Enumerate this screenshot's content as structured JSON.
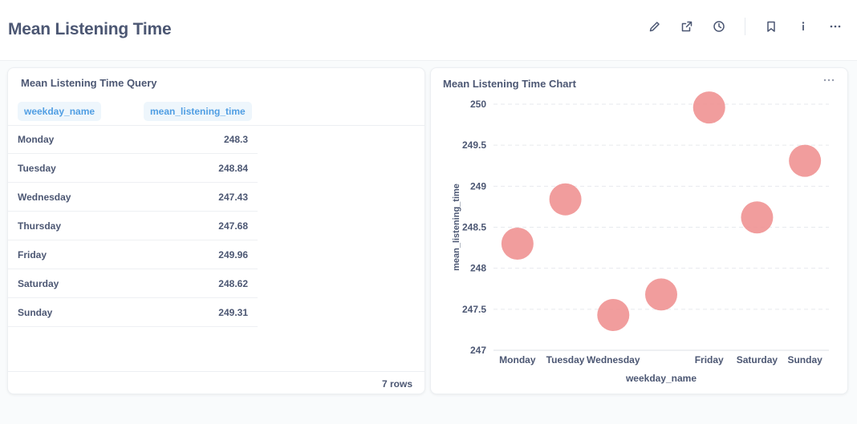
{
  "header": {
    "title": "Mean Listening Time",
    "icons": [
      "pencil-icon",
      "external-link-icon",
      "clock-icon",
      "bookmark-icon",
      "info-icon",
      "more-icon"
    ]
  },
  "query_card": {
    "title": "Mean Listening Time Query",
    "columns": [
      "weekday_name",
      "mean_listening_time"
    ],
    "rows": [
      {
        "day": "Monday",
        "value": "248.3"
      },
      {
        "day": "Tuesday",
        "value": "248.84"
      },
      {
        "day": "Wednesday",
        "value": "247.43"
      },
      {
        "day": "Thursday",
        "value": "247.68"
      },
      {
        "day": "Friday",
        "value": "249.96"
      },
      {
        "day": "Saturday",
        "value": "248.62"
      },
      {
        "day": "Sunday",
        "value": "249.31"
      }
    ],
    "row_count": "7 rows"
  },
  "chart_card": {
    "title": "Mean Listening Time Chart"
  },
  "chart_data": {
    "type": "scatter",
    "title": "Mean Listening Time Chart",
    "xlabel": "weekday_name",
    "ylabel": "mean_listening_time",
    "categories": [
      "Monday",
      "Tuesday",
      "Wednesday",
      "Thursday",
      "Friday",
      "Saturday",
      "Sunday"
    ],
    "x_tick_labels": [
      "Monday",
      "Tuesday",
      "Wednesday",
      "",
      "Friday",
      "Saturday",
      "Sunday"
    ],
    "values": [
      248.3,
      248.84,
      247.43,
      247.68,
      249.96,
      248.62,
      249.31
    ],
    "y_ticks": [
      "247",
      "247.5",
      "248",
      "248.5",
      "249",
      "249.5",
      "250"
    ],
    "ylim": [
      247,
      250
    ],
    "grid": true,
    "color": "#ef8c8c"
  },
  "colors": {
    "text": "#4c5773",
    "accent": "#509ee3",
    "point": "#ef8c8c"
  }
}
